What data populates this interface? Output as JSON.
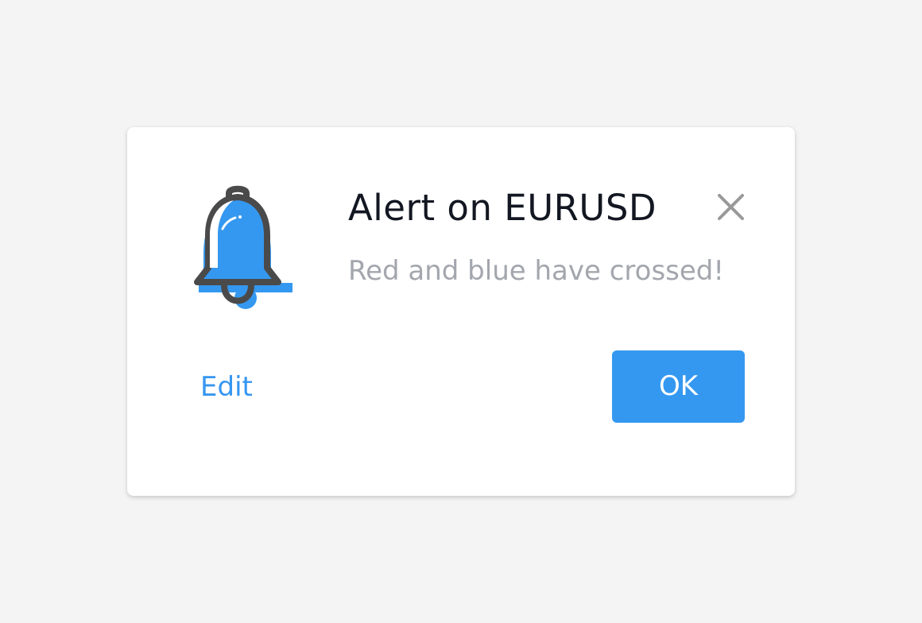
{
  "dialog": {
    "icon": "bell-icon",
    "title": "Alert on EURUSD",
    "message": "Red and blue have crossed!",
    "close_icon": "close-icon",
    "edit_label": "Edit",
    "ok_label": "OK"
  },
  "colors": {
    "accent": "#3598f0",
    "title_text": "#131722",
    "message_text": "#a3a6ad",
    "icon_outline": "#4a4a4a",
    "background": "#f4f4f4"
  }
}
